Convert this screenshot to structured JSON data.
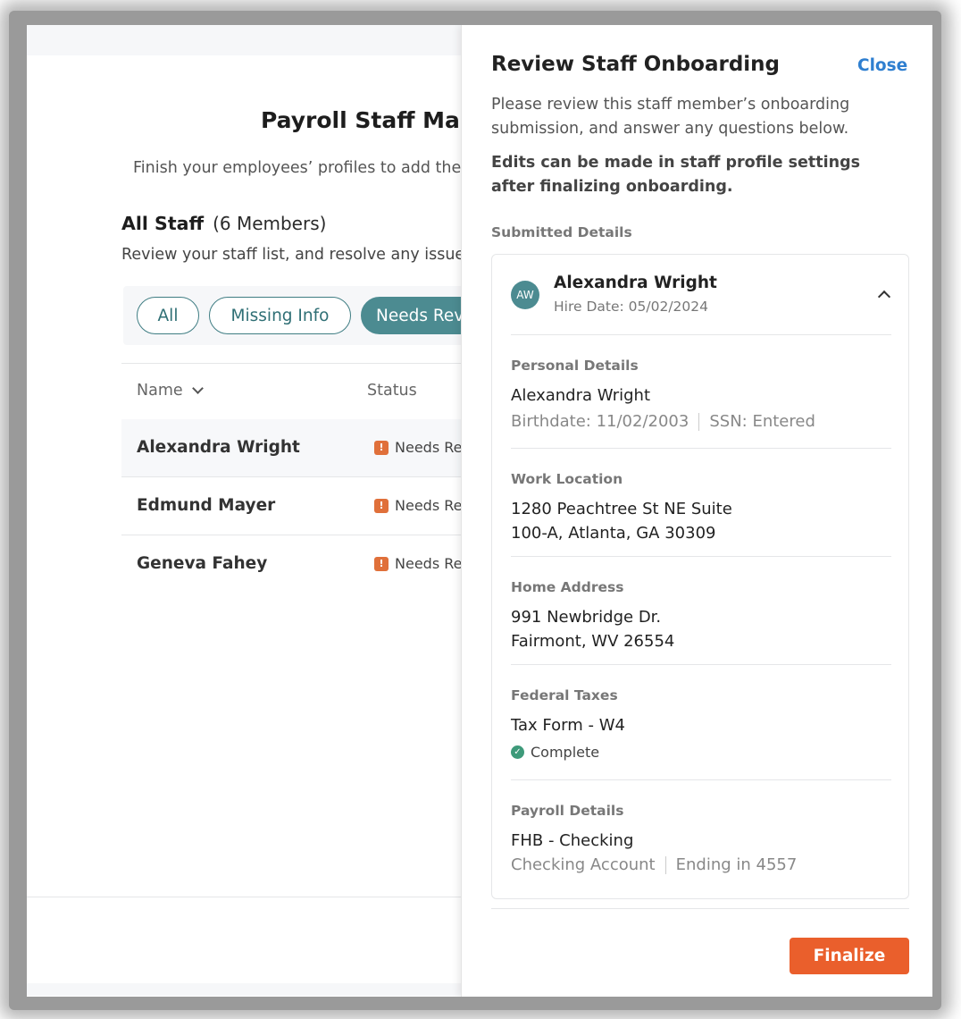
{
  "background": {
    "title": "Payroll Staff Mar",
    "subtitle": "Finish your employees’ profiles to add the",
    "staff_heading": "All Staff",
    "staff_count": "(6 Members)",
    "staff_sub": "Review your staff list, and resolve any issue",
    "filters": [
      {
        "label": "All"
      },
      {
        "label": "Missing Info"
      },
      {
        "label": "Needs Rev"
      }
    ],
    "table": {
      "col_name": "Name",
      "col_status": "Status",
      "rows": [
        {
          "name": "Alexandra Wright",
          "status": "Needs Re"
        },
        {
          "name": "Edmund Mayer",
          "status": "Needs Re"
        },
        {
          "name": "Geneva Fahey",
          "status": "Needs Re"
        }
      ]
    }
  },
  "drawer": {
    "title": "Review Staff Onboarding",
    "close_label": "Close",
    "description": "Please review this staff member’s onboarding submission, and answer any questions below.",
    "note": "Edits can be made in staff profile settings after finalizing onboarding.",
    "section_label": "Submitted Details",
    "employee": {
      "initials": "AW",
      "name": "Alexandra Wright",
      "hire_date": "Hire Date: 05/02/2024"
    },
    "personal": {
      "label": "Personal Details",
      "name": "Alexandra Wright",
      "birthdate": "Birthdate: 11/02/2003",
      "ssn": "SSN: Entered"
    },
    "work_location": {
      "label": "Work Location",
      "line1": "1280 Peachtree St NE Suite",
      "line2": "100-A, Atlanta, GA 30309"
    },
    "home_address": {
      "label": "Home Address",
      "line1": "991 Newbridge Dr.",
      "line2": "Fairmont, WV 26554"
    },
    "federal_taxes": {
      "label": "Federal Taxes",
      "form": "Tax Form - W4",
      "status": "Complete"
    },
    "payroll": {
      "label": "Payroll Details",
      "bank": "FHB - Checking",
      "account_type": "Checking Account",
      "ending": "Ending in 4557"
    },
    "finalize_label": "Finalize"
  },
  "colors": {
    "accent": "#4c8b91",
    "warning": "#e0703a",
    "success": "#3e9a7a",
    "link": "#2f7fd0",
    "primary_button": "#ea5f2c"
  }
}
